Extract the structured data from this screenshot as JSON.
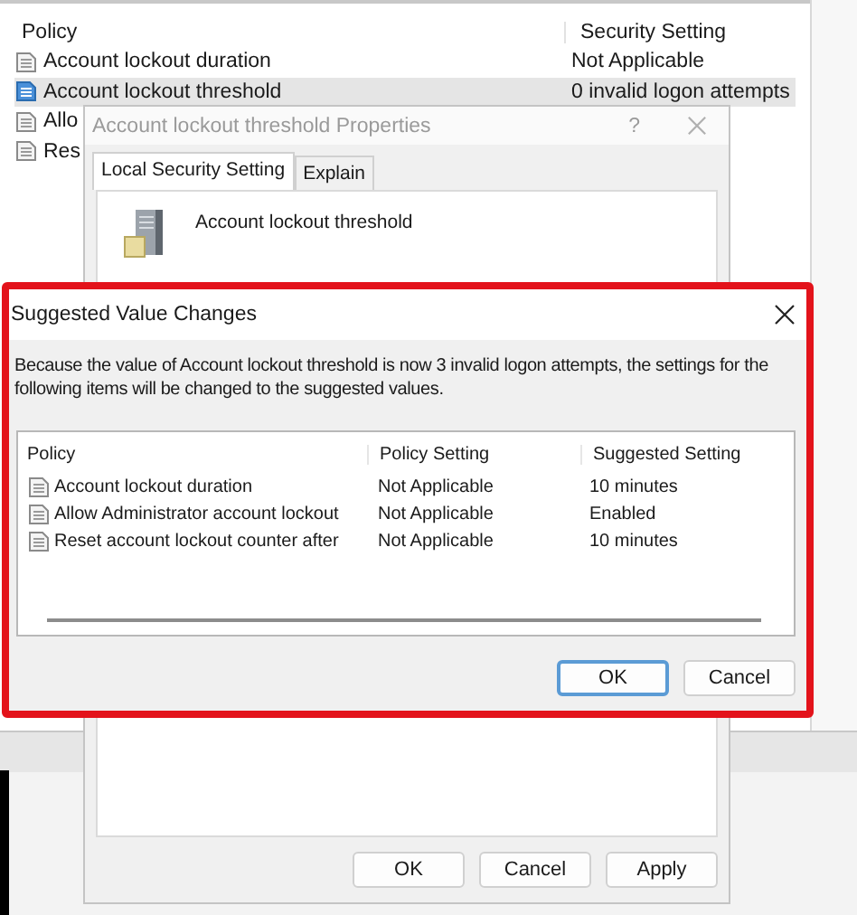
{
  "policy_list": {
    "columns": [
      "Policy",
      "Security Setting"
    ],
    "rows": [
      {
        "policy": "Account lockout duration",
        "setting": "Not Applicable",
        "selected": false
      },
      {
        "policy": "Account lockout threshold",
        "setting": "0 invalid logon attempts",
        "selected": true
      },
      {
        "policy": "Allo",
        "selected": false
      },
      {
        "policy": "Res",
        "selected": false
      }
    ]
  },
  "properties_dialog": {
    "title": "Account lockout threshold Properties",
    "help": "?",
    "tabs": [
      {
        "label": "Local Security Setting",
        "selected": true
      },
      {
        "label": "Explain",
        "selected": false
      }
    ],
    "policy_name": "Account lockout threshold",
    "buttons": [
      "OK",
      "Cancel",
      "Apply"
    ]
  },
  "suggested_dialog": {
    "title": "Suggested Value Changes",
    "message": "Because the value of Account lockout threshold is now 3 invalid logon attempts, the settings for the following items will be changed to the suggested values.",
    "columns": [
      "Policy",
      "Policy Setting",
      "Suggested Setting"
    ],
    "rows": [
      {
        "policy": "Account lockout duration",
        "policy_setting": "Not Applicable",
        "suggested_setting": "10 minutes"
      },
      {
        "policy": "Allow Administrator account lockout",
        "policy_setting": "Not Applicable",
        "suggested_setting": "Enabled"
      },
      {
        "policy": "Reset account lockout counter after",
        "policy_setting": "Not Applicable",
        "suggested_setting": "10 minutes"
      }
    ],
    "buttons": [
      {
        "label": "OK",
        "focused": true
      },
      {
        "label": "Cancel",
        "focused": false
      }
    ]
  }
}
